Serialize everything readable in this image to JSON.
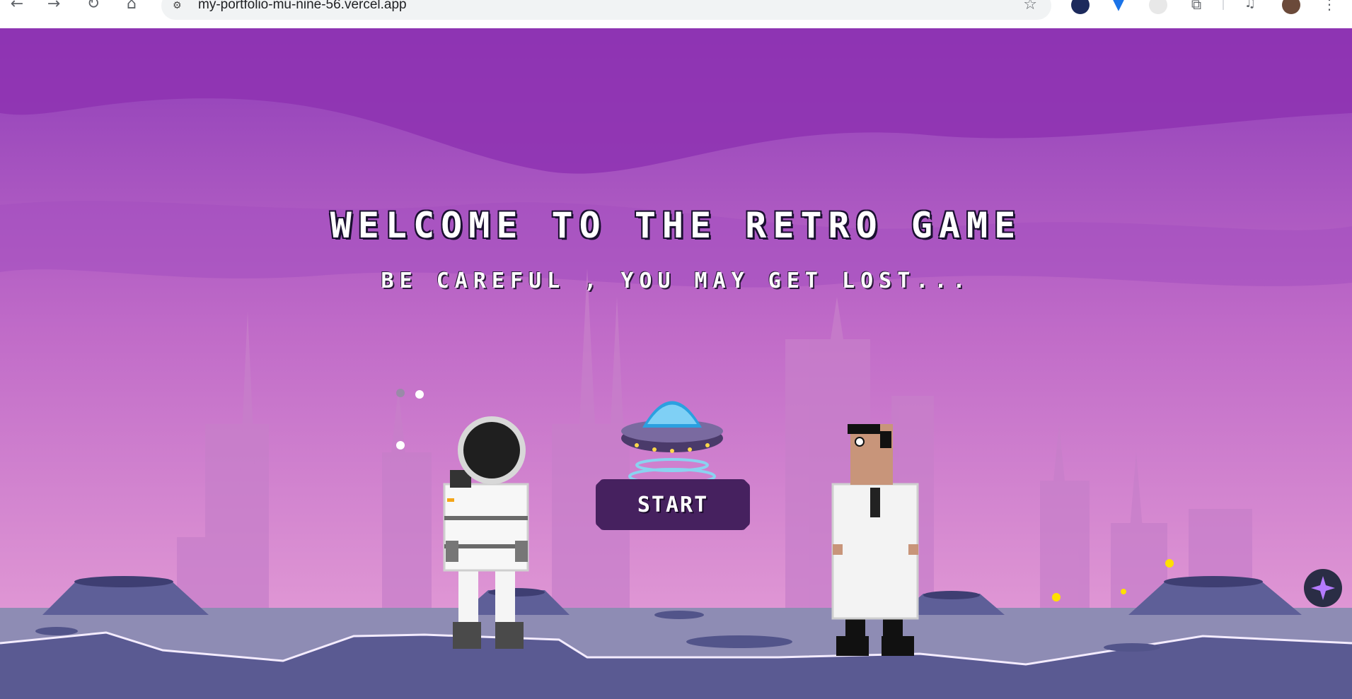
{
  "browser": {
    "url": "my-portfolio-mu-nine-56.vercel.app"
  },
  "game": {
    "title": "WELCOME TO THE RETRO GAME",
    "subtitle": "BE CAREFUL , YOU MAY GET LOST...",
    "start_label": "START"
  },
  "colors": {
    "sky_top": "#8e3db8",
    "sky_bottom": "#e39ad6",
    "button_bg": "#46215f",
    "ground": "#8e8cb4"
  }
}
